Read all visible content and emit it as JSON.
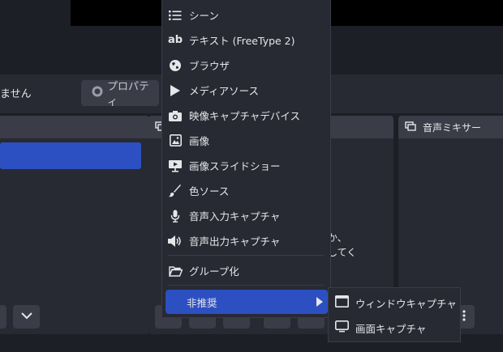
{
  "toolbar": {
    "no_source_text": "ません",
    "properties_label": "プロパティ"
  },
  "docks": {
    "right_title": "音声ミキサー",
    "mid_text_1": "か、",
    "mid_text_2": "してく"
  },
  "menu": {
    "items": [
      {
        "label": "シーン",
        "icon": "list-icon"
      },
      {
        "label": "テキスト (FreeType 2)",
        "icon": "text-ab-icon"
      },
      {
        "label": "ブラウザ",
        "icon": "globe-icon"
      },
      {
        "label": "メディアソース",
        "icon": "play-icon"
      },
      {
        "label": "映像キャプチャデバイス",
        "icon": "camera-icon"
      },
      {
        "label": "画像",
        "icon": "image-icon"
      },
      {
        "label": "画像スライドショー",
        "icon": "slideshow-icon"
      },
      {
        "label": "色ソース",
        "icon": "brush-icon"
      },
      {
        "label": "音声入力キャプチャ",
        "icon": "microphone-icon"
      },
      {
        "label": "音声出力キャプチャ",
        "icon": "speaker-icon"
      },
      {
        "label": "グループ化",
        "icon": "folder-icon"
      },
      {
        "label": "非推奨",
        "icon": "chevron-right-icon"
      }
    ]
  },
  "submenu": {
    "items": [
      {
        "label": "ウィンドウキャプチャ",
        "icon": "window-icon"
      },
      {
        "label": "画面キャプチャ",
        "icon": "monitor-icon"
      }
    ]
  },
  "colors": {
    "accent": "#2c50c1",
    "panel": "#272a33",
    "header": "#3a3d47",
    "background": "#1d1f26"
  }
}
